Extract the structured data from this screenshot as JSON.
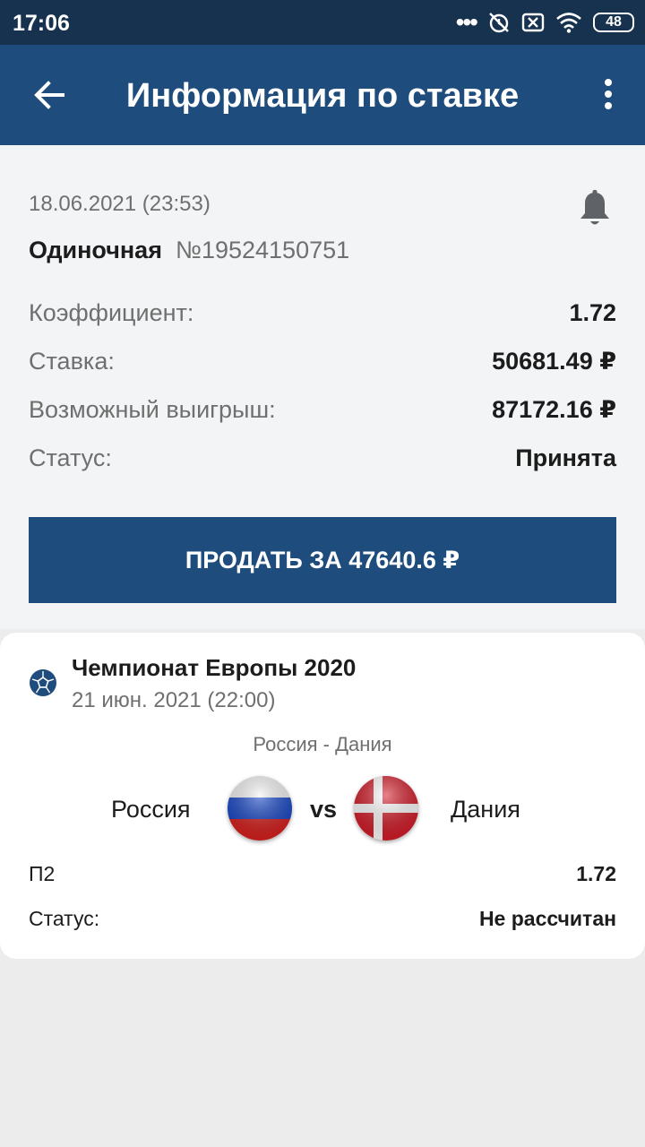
{
  "status_bar": {
    "time": "17:06",
    "battery": "48"
  },
  "header": {
    "title": "Информация по ставке"
  },
  "bet": {
    "datetime": "18.06.2021 (23:53)",
    "type": "Одиночная",
    "number": "№19524150751",
    "rows": [
      {
        "label": "Коэффициент:",
        "value": "1.72"
      },
      {
        "label": "Ставка:",
        "value": "50681.49 ₽"
      },
      {
        "label": "Возможный выигрыш:",
        "value": "87172.16 ₽"
      },
      {
        "label": "Статус:",
        "value": "Принята"
      }
    ],
    "sell_button": "ПРОДАТЬ ЗА 47640.6 ₽"
  },
  "event": {
    "tournament": "Чемпионат Европы 2020",
    "date": "21 июн. 2021 (22:00)",
    "match": "Россия - Дания",
    "home": "Россия",
    "vs": "vs",
    "away": "Дания",
    "outcome_label": "П2",
    "outcome_value": "1.72",
    "status_label": "Статус:",
    "status_value": "Не рассчитан"
  },
  "colors": {
    "header": "#1e4c7c",
    "status_bar": "#17324f",
    "button": "#1e4c7c"
  },
  "icons": [
    "back-arrow-icon",
    "more-vert-icon",
    "bell-icon",
    "soccer-ball-icon",
    "russia-flag-icon",
    "denmark-flag-icon"
  ]
}
